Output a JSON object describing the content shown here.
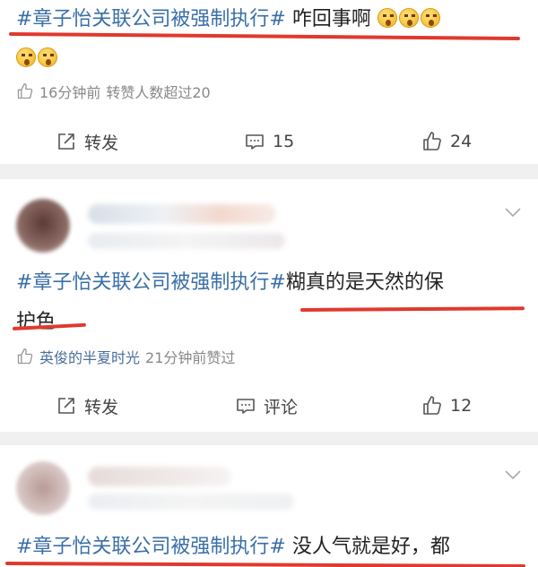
{
  "posts": [
    {
      "tag": "#章子怡关联公司被强制执行#",
      "text": " 咋回事啊",
      "meta_time": "16分钟前",
      "meta_extra": "转赞人数超过20",
      "repost_label": "转发",
      "comment_count": "15",
      "like_count": "24"
    },
    {
      "tag": "#章子怡关联公司被强制执行#",
      "text_line1": "糊真的是天然的保",
      "text_line2": "护色",
      "liker_name": "英俊的半夏时光",
      "liker_time": "21分钟前赞过",
      "repost_label": "转发",
      "comment_label": "评论",
      "like_count": "12"
    },
    {
      "tag": "#章子怡关联公司被强制执行#",
      "text": " 没人气就是好，都"
    }
  ],
  "icons": {
    "thumb": "thumb-up-icon",
    "repost": "repost-icon",
    "comment": "comment-icon",
    "chevron": "chevron-down-icon"
  },
  "colors": {
    "tag": "#3a6fa8",
    "underline": "#e0392f",
    "background": "#f0f0f0"
  }
}
